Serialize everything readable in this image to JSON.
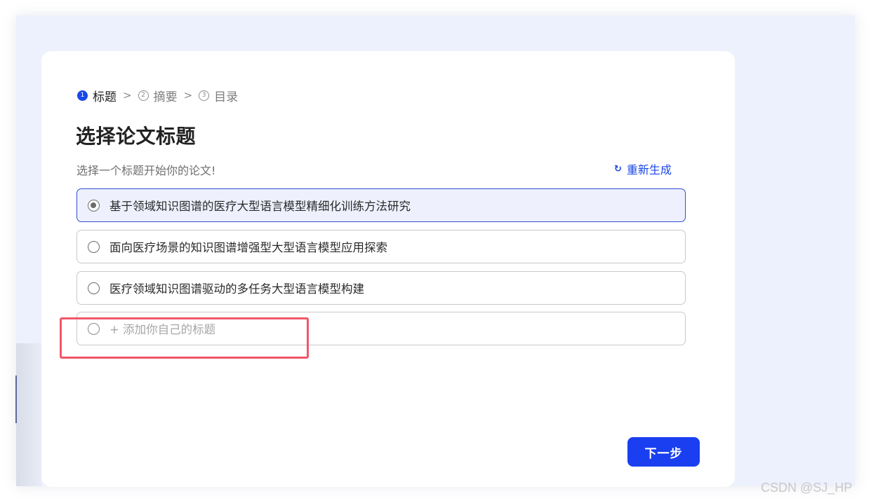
{
  "steps": [
    {
      "num": "1",
      "label": "标题",
      "active": true
    },
    {
      "num": "2",
      "label": "摘要",
      "active": false
    },
    {
      "num": "3",
      "label": "目录",
      "active": false
    }
  ],
  "step_separator": ">",
  "page_title": "选择论文标题",
  "subtitle": "选择一个标题开始你的论文!",
  "regenerate": {
    "icon": "refresh-icon",
    "glyph": "↻",
    "label": "重新生成"
  },
  "options": [
    {
      "label": "基于领域知识图谱的医疗大型语言模型精细化训练方法研究",
      "selected": true
    },
    {
      "label": "面向医疗场景的知识图谱增强型大型语言模型应用探索",
      "selected": false
    },
    {
      "label": "医疗领域知识图谱驱动的多任务大型语言模型构建",
      "selected": false
    }
  ],
  "add_option": {
    "label": "+ 添加你自己的标题"
  },
  "next_button": {
    "label": "下一步"
  },
  "watermark": "CSDN @SJ_HP",
  "colors": {
    "accent": "#1a47e6",
    "button": "#1a3ff0",
    "backdrop": "#edf1fd",
    "selected_bg": "#eef1fd",
    "highlight": "#f2566a"
  }
}
